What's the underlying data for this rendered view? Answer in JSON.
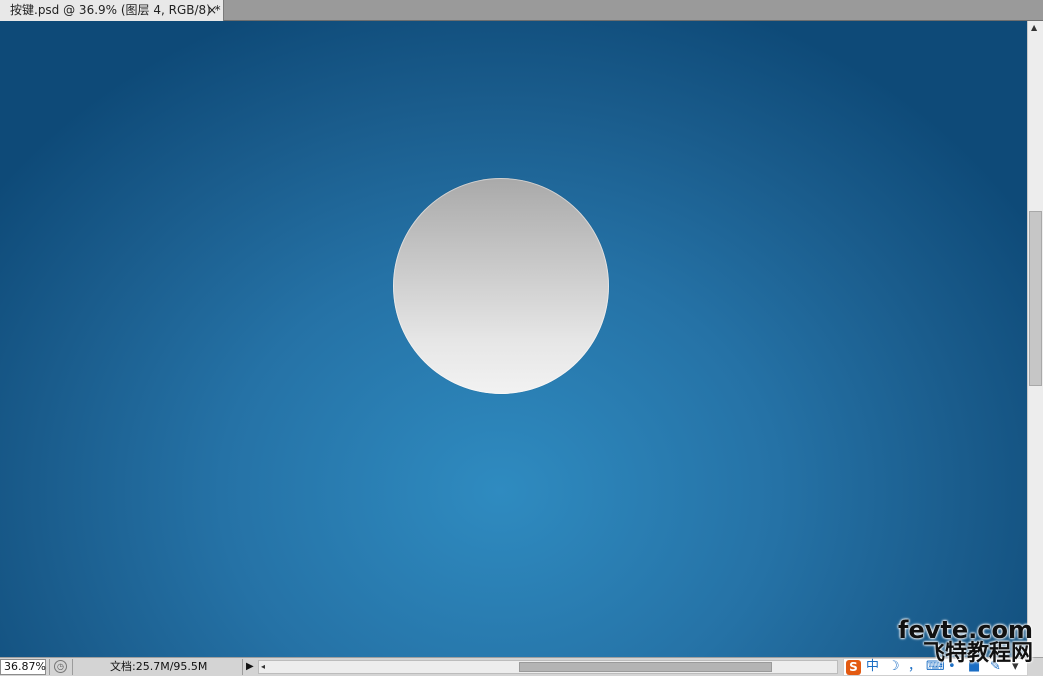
{
  "document_tab": {
    "title": "按键.psd @ 36.9% (图层 4, RGB/8) *",
    "close": "×"
  },
  "canvas": {
    "background_colors": [
      "#2f8bc0",
      "#2572a6",
      "#0e4a78"
    ],
    "circle_colors": [
      "#a9a9a9",
      "#f2f2f2"
    ]
  },
  "status_bar": {
    "zoom": "36.87%",
    "doc_info": "文档:25.7M/95.5M",
    "menu_arrow": "▶",
    "scroll_left_arrow": "◂"
  },
  "ime_bar": {
    "logo": "S",
    "mode": "中",
    "moon": "☽",
    "punct": "，",
    "keyboard": "⌨",
    "dot": "•",
    "shirt": "■",
    "wrench": "✎",
    "more": "▾"
  },
  "watermark": {
    "line1": "fevte.com",
    "line2": "飞特教程网"
  }
}
